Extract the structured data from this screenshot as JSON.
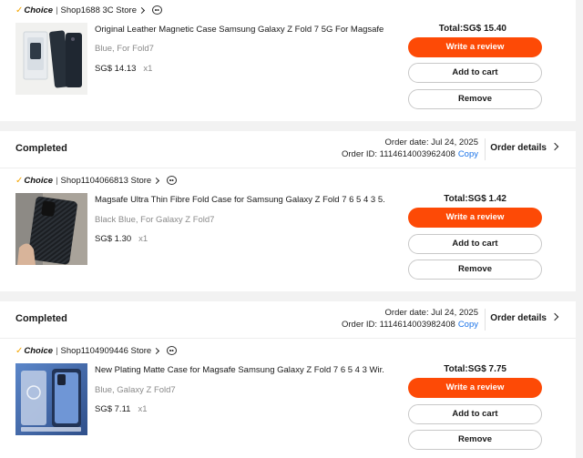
{
  "orders": [
    {
      "store_choice": "Choice",
      "store_name": "Shop1688 3C Store",
      "product_title": "Original Leather Magnetic Case Samsung Galaxy Z Fold 7 5G For Magsafe...",
      "variant": "Blue, For Fold7",
      "price": "SG$ 14.13",
      "qty": "x1",
      "total": "Total:SG$ 15.40",
      "btn_review": "Write a review",
      "btn_cart": "Add to cart",
      "btn_remove": "Remove"
    },
    {
      "status": "Completed",
      "order_date": "Order date: Jul 24, 2025",
      "order_id": "Order ID: 1114614003962408",
      "copy": "Copy",
      "details": "Order details",
      "store_choice": "Choice",
      "store_name": "Shop1104066813 Store",
      "product_title": "Magsafe Ultra Thin Fibre Fold Case for Samsung Galaxy Z Fold 7 6 5 4 3 5...",
      "variant": "Black Blue, For Galaxy Z Fold7",
      "price": "SG$ 1.30",
      "qty": "x1",
      "total": "Total:SG$ 1.42",
      "btn_review": "Write a review",
      "btn_cart": "Add to cart",
      "btn_remove": "Remove"
    },
    {
      "status": "Completed",
      "order_date": "Order date: Jul 24, 2025",
      "order_id": "Order ID: 1114614003982408",
      "copy": "Copy",
      "details": "Order details",
      "store_choice": "Choice",
      "store_name": "Shop1104909446 Store",
      "product_title": "New Plating Matte Case for Magsafe Samsung Galaxy Z Fold 7 6 5 4 3 Wir...",
      "variant": "Blue, Galaxy Z Fold7",
      "price": "SG$ 7.11",
      "qty": "x1",
      "total": "Total:SG$ 7.75",
      "btn_review": "Write a review",
      "btn_cart": "Add to cart",
      "btn_remove": "Remove"
    }
  ],
  "colors": {
    "accent": "#fd4a06",
    "link": "#1a73e8",
    "choice_check": "#f5a500"
  },
  "icons": [
    "check-icon",
    "chevron-right-icon",
    "chat-icon"
  ]
}
